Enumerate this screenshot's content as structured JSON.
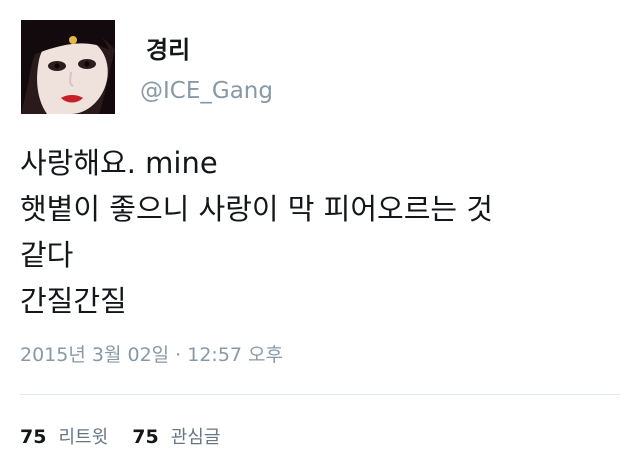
{
  "user": {
    "display_name": "경리",
    "handle": "@ICE_Gang",
    "avatar_icon": "profile-photo"
  },
  "tweet": {
    "lines": [
      "사랑해요. mine",
      "햇볕이 좋으니 사랑이 막 피어오르는 것",
      "같다",
      "간질간질"
    ],
    "timestamp": "2015년 3월 02일 · 12:57 오후"
  },
  "stats": {
    "retweets": {
      "count": "75",
      "label": "리트윗"
    },
    "likes": {
      "count": "75",
      "label": "관심글"
    }
  },
  "colors": {
    "text": "#14171a",
    "muted": "#8899a6",
    "divider": "#e1e8ed"
  }
}
